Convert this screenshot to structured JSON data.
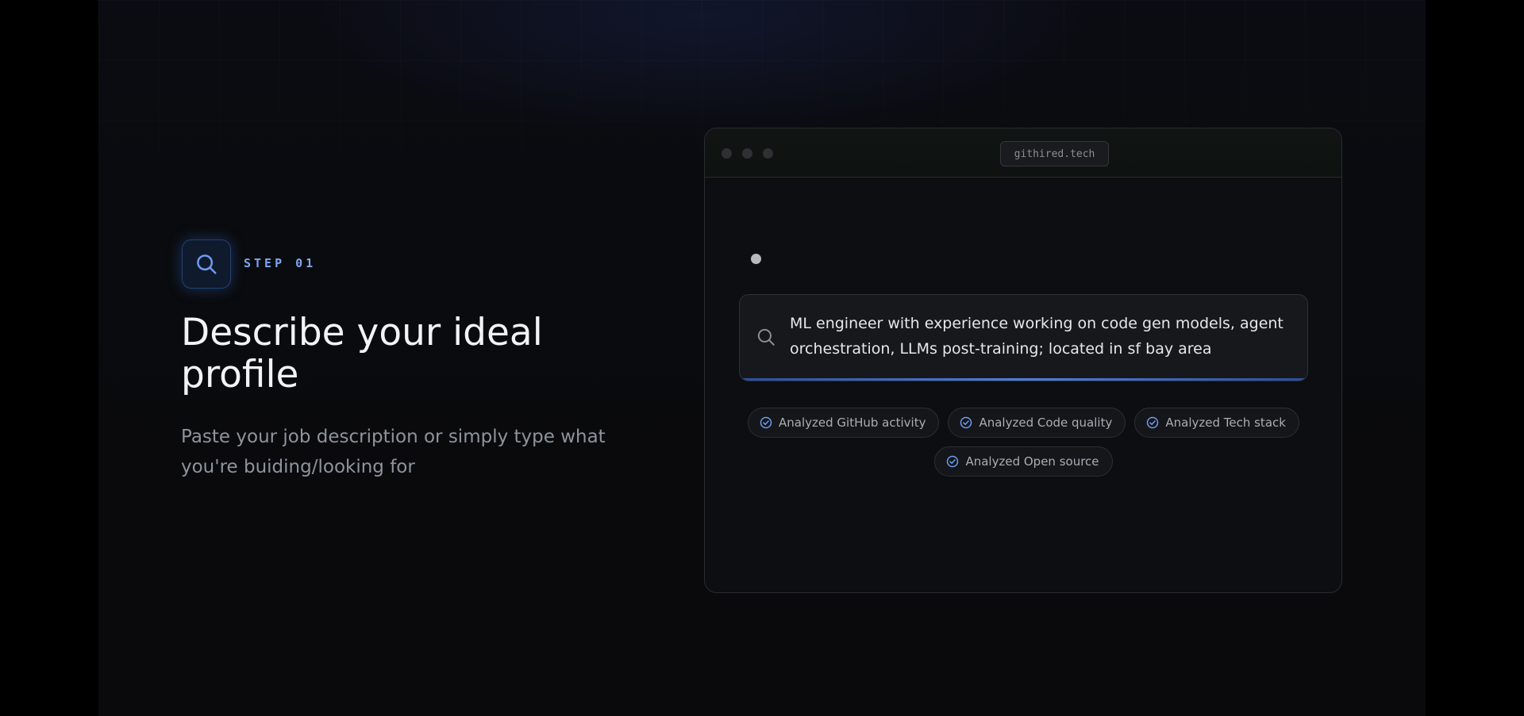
{
  "step": {
    "icon": "search-icon",
    "label": "STEP 01",
    "accent_color": "#7fa6ee"
  },
  "hero": {
    "title": "Describe your ideal profile",
    "subtitle": "Paste your job description or simply type what you're buiding/looking for"
  },
  "browser": {
    "url": "githired.tech",
    "search": {
      "icon": "search-icon",
      "query": "ML engineer with experience working on code gen models, agent orchestration, LLMs post-training; located in sf bay area"
    },
    "chips": [
      {
        "label": "Analyzed GitHub activity",
        "icon": "check-circle-icon"
      },
      {
        "label": "Analyzed Code quality",
        "icon": "check-circle-icon"
      },
      {
        "label": "Analyzed Tech stack",
        "icon": "check-circle-icon"
      },
      {
        "label": "Analyzed Open source",
        "icon": "check-circle-icon"
      }
    ]
  }
}
